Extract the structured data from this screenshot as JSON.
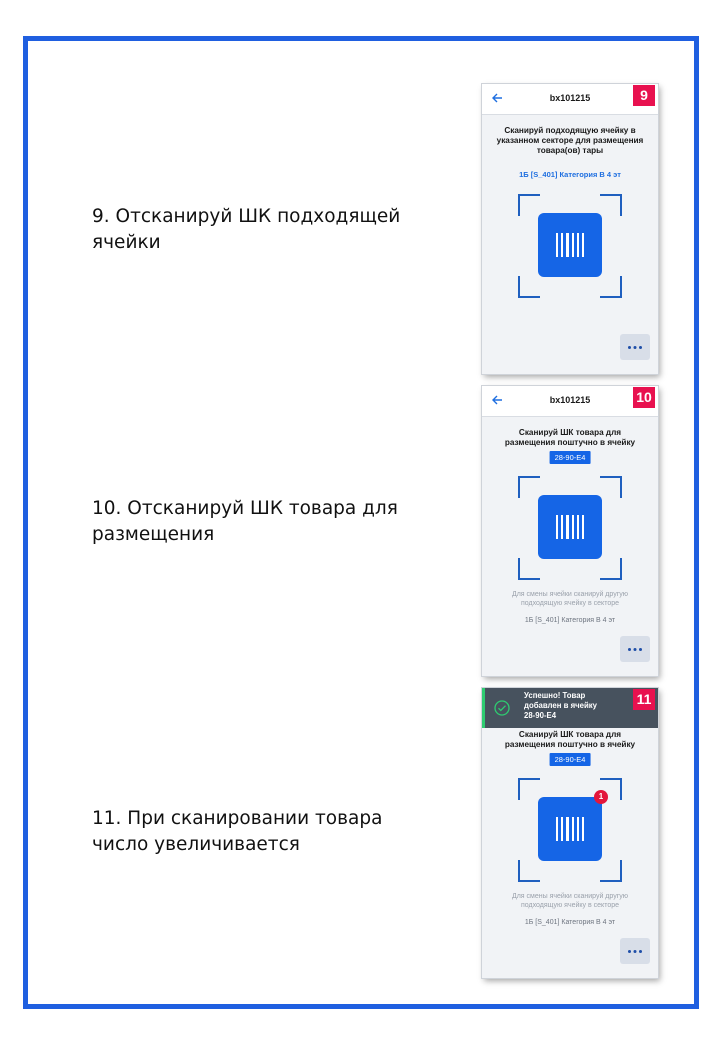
{
  "steps": [
    {
      "text": [
        "9. Отсканируй ШК подходящей",
        "ячейки"
      ],
      "phone": {
        "code": "bx101215",
        "badge": "9",
        "instruction": [
          "Сканируй подходящую ячейку в",
          "указанном секторе для размещения",
          "товара(ов) тары"
        ],
        "location": "1Б [S_401] Категория В 4 эт"
      }
    },
    {
      "text": [
        "10. Отсканируй ШК товара для",
        "размещения"
      ],
      "phone": {
        "code": "bx101215",
        "badge": "10",
        "instruction": [
          "Сканируй ШК товара для",
          "размещения поштучно в ячейку"
        ],
        "cell": "28-90-E4",
        "note": [
          "Для смены ячейки сканируй другую",
          "подходящую ячейку в секторе"
        ],
        "location": "1Б [S_401] Категория В 4 эт"
      }
    },
    {
      "text": [
        "11. При сканировании товара",
        "число увеличивается"
      ],
      "phone": {
        "badge": "11",
        "toast": [
          "Успешно! Товар",
          "добавлен в ячейку",
          "28-90-E4"
        ],
        "instruction": [
          "Сканируй ШК товара для",
          "размещения поштучно в ячейку"
        ],
        "cell": "28-90-E4",
        "count": "1",
        "note": [
          "Для смены ячейки сканируй другую",
          "подходящую ячейку в секторе"
        ],
        "location": "1Б [S_401] Категория В 4 эт"
      }
    }
  ],
  "icons": {
    "back": "arrow-left-icon",
    "barcode": "barcode-icon",
    "more": "more-dots-icon",
    "success": "check-circle-icon"
  },
  "colors": {
    "frame": "#1f5fe0",
    "accent": "#1565e6",
    "badge": "#e8114f",
    "toast": "#47525e",
    "success": "#2ecc71"
  }
}
